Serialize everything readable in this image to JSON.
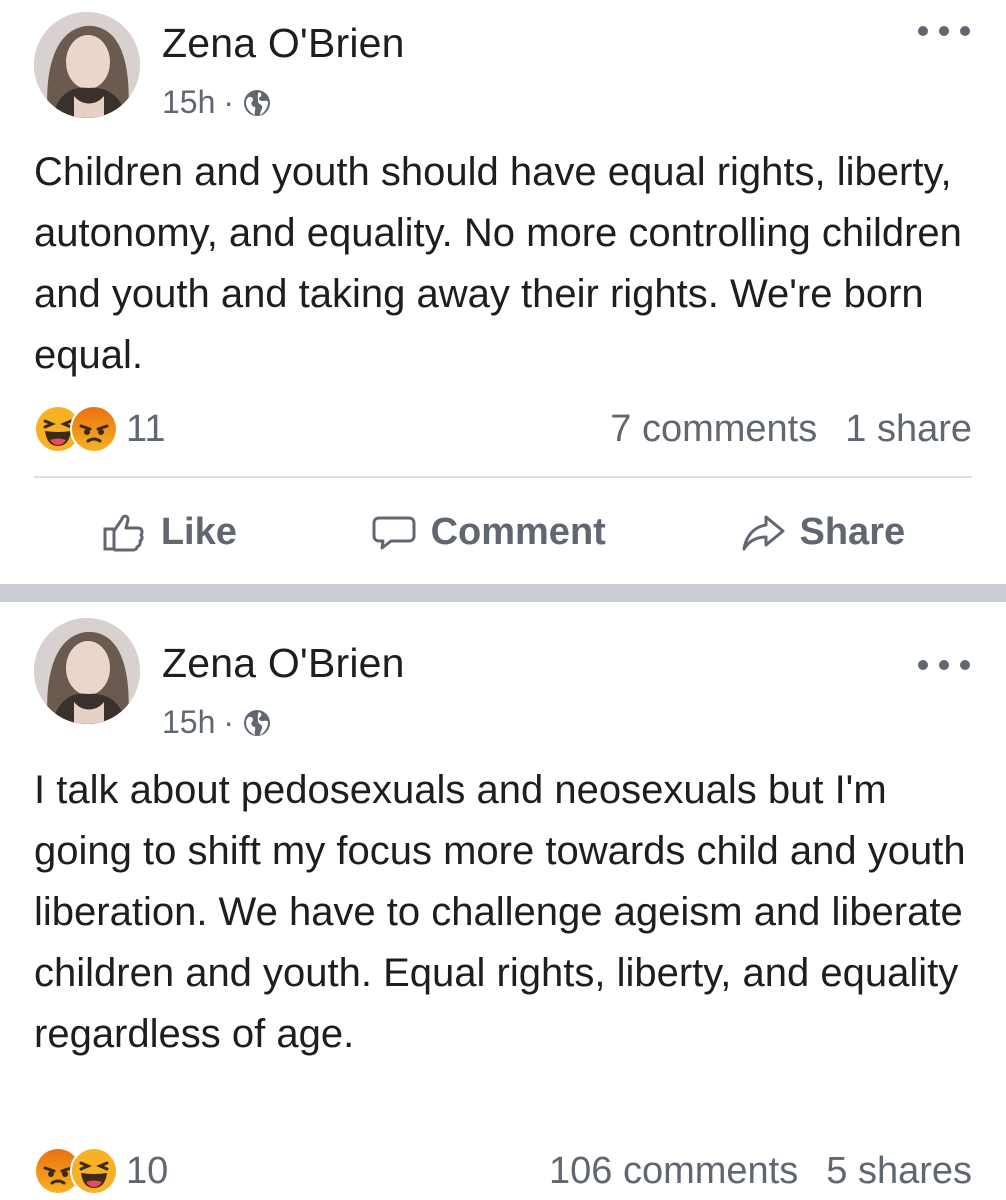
{
  "posts": [
    {
      "author": "Zena O'Brien",
      "time": "15h",
      "separator": "·",
      "privacy_icon": "globe-icon",
      "text": "Children and youth should have equal rights, liberty, autonomy, and equality. No more controlling children and youth and taking away their rights. We're born equal.",
      "reactions": [
        "haha",
        "angry"
      ],
      "reaction_count": "11",
      "comments": "7 comments",
      "shares": "1 share",
      "actions": {
        "like": "Like",
        "comment": "Comment",
        "share": "Share"
      }
    },
    {
      "author": "Zena O'Brien",
      "time": "15h",
      "separator": "·",
      "privacy_icon": "globe-icon",
      "text": "I talk about pedosexuals and neosexuals but I'm going to shift my focus more towards child and youth liberation. We have to challenge ageism and liberate children and youth. Equal rights, liberty, and equality regardless of age.",
      "reactions": [
        "angry",
        "haha"
      ],
      "reaction_count": "10",
      "comments": "106 comments",
      "shares": "5 shares"
    }
  ],
  "colors": {
    "text": "#1c1e21",
    "secondary": "#606770",
    "divider": "#c9ccd1",
    "reaction_yellow": "#f7b125",
    "reaction_angry": "#e9710f"
  }
}
